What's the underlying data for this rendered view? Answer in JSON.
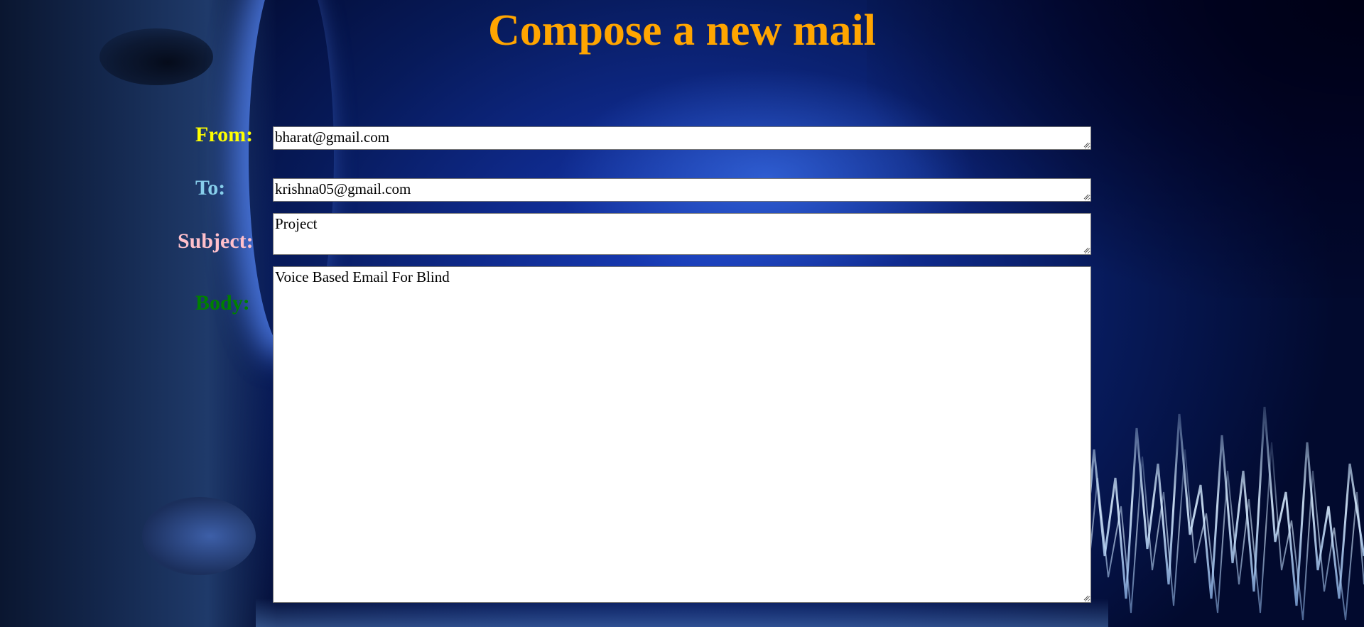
{
  "page": {
    "title": "Compose a new mail"
  },
  "form": {
    "from": {
      "label": "From:",
      "value": "bharat@gmail.com",
      "label_color": "#ffff00"
    },
    "to": {
      "label": "To:",
      "value": "krishna05@gmail.com",
      "label_color": "#87ceeb"
    },
    "subject": {
      "label": "Subject:",
      "value": "Project",
      "label_color": "#ffc0cb"
    },
    "body": {
      "label": "Body:",
      "value": "Voice Based Email For Blind",
      "label_color": "#008000"
    }
  },
  "theme": {
    "title_color": "#ffa500",
    "background": "blue face / sound-wave image"
  }
}
